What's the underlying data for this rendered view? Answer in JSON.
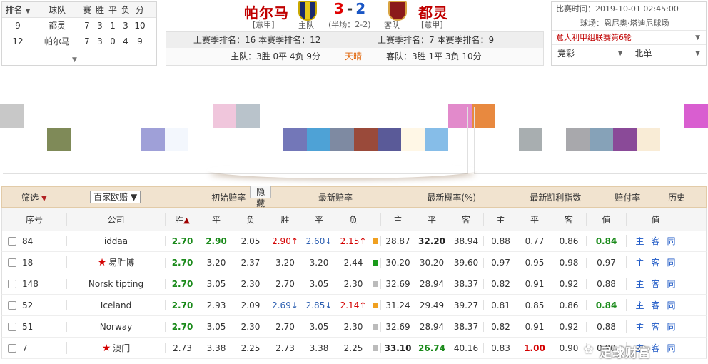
{
  "standings": {
    "headers": [
      "排名",
      "球队",
      "赛",
      "胜",
      "平",
      "负",
      "分"
    ],
    "rows": [
      {
        "rank": "9",
        "team": "都灵",
        "p": "7",
        "w": "3",
        "d": "1",
        "l": "3",
        "pts": "10"
      },
      {
        "rank": "12",
        "team": "帕尔马",
        "p": "7",
        "w": "3",
        "d": "0",
        "l": "4",
        "pts": "9"
      }
    ]
  },
  "match": {
    "home": "帕尔马",
    "away": "都灵",
    "home_league": "[意甲]",
    "away_league": "[意甲]",
    "home_caption": "主队",
    "away_caption": "客队",
    "score_home": "3",
    "score_sep": "-",
    "score_away": "2",
    "half": "(半场：2-2)",
    "home_rank_line": "上赛季排名：16 本赛季排名：12",
    "away_rank_line": "上赛季排名：7 本赛季排名：9",
    "home_record": "主队：3胜 0平 4负 9分",
    "weather": "天晴",
    "away_record": "客队：3胜 1平 3负 10分"
  },
  "right_panel": {
    "time": "比赛时间：2019-10-01 02:45:00",
    "venue": "球场：恩尼奥·塔迪尼球场",
    "round": "意大利甲组联赛第6轮",
    "select1": "竞彩",
    "select2": "北单"
  },
  "toolbar": {
    "filter": "筛选",
    "company_select": "百家欧赔",
    "initial": "初始赔率",
    "hide": "隐藏",
    "latest": "最新赔率",
    "prob": "最新概率(%)",
    "kelly": "最新凯利指数",
    "payout": "赔付率",
    "history": "历史"
  },
  "columns": {
    "idx": "序号",
    "company": "公司",
    "win": "胜",
    "draw": "平",
    "loss": "负",
    "h": "主",
    "d": "平",
    "a": "客",
    "val": "值",
    "val2": "值"
  },
  "rows": [
    {
      "idx": "84",
      "company": "iddaa",
      "star": false,
      "i_w": "2.70",
      "i_d": "2.90",
      "i_l": "2.05",
      "l_w": "2.90↑",
      "l_d": "2.60↓",
      "l_l": "2.15↑",
      "sq": "#f0a020",
      "p_h": "28.87",
      "p_d": "32.20",
      "p_a": "38.94",
      "k_h": "0.88",
      "k_d": "0.77",
      "k_a": "0.86",
      "pay": "0.84",
      "links": [
        "主",
        "客",
        "同"
      ]
    },
    {
      "idx": "18",
      "company": "易胜博",
      "star": true,
      "i_w": "2.70",
      "i_d": "3.20",
      "i_l": "2.37",
      "l_w": "3.20",
      "l_d": "3.20",
      "l_l": "2.44",
      "sq": "#1a9a1a",
      "p_h": "30.20",
      "p_d": "30.20",
      "p_a": "39.60",
      "k_h": "0.97",
      "k_d": "0.95",
      "k_a": "0.98",
      "pay": "0.97",
      "links": [
        "主",
        "客",
        "同"
      ]
    },
    {
      "idx": "148",
      "company": "Norsk tipting",
      "star": false,
      "i_w": "2.70",
      "i_d": "3.05",
      "i_l": "2.30",
      "l_w": "2.70",
      "l_d": "3.05",
      "l_l": "2.30",
      "sq": "#bbbbbb",
      "p_h": "32.69",
      "p_d": "28.94",
      "p_a": "38.37",
      "k_h": "0.82",
      "k_d": "0.91",
      "k_a": "0.92",
      "pay": "0.88",
      "links": [
        "主",
        "客",
        "同"
      ]
    },
    {
      "idx": "52",
      "company": "Iceland",
      "star": false,
      "i_w": "2.70",
      "i_d": "2.93",
      "i_l": "2.09",
      "l_w": "2.69↓",
      "l_d": "2.85↓",
      "l_l": "2.14↑",
      "sq": "#f0a020",
      "p_h": "31.24",
      "p_d": "29.49",
      "p_a": "39.27",
      "k_h": "0.81",
      "k_d": "0.85",
      "k_a": "0.86",
      "pay": "0.84",
      "links": [
        "主",
        "客",
        "同"
      ]
    },
    {
      "idx": "51",
      "company": "Norway",
      "star": false,
      "i_w": "2.70",
      "i_d": "3.05",
      "i_l": "2.30",
      "l_w": "2.70",
      "l_d": "3.05",
      "l_l": "2.30",
      "sq": "#bbbbbb",
      "p_h": "32.69",
      "p_d": "28.94",
      "p_a": "38.37",
      "k_h": "0.82",
      "k_d": "0.91",
      "k_a": "0.92",
      "pay": "0.88",
      "links": [
        "主",
        "客",
        "同"
      ]
    },
    {
      "idx": "7",
      "company": "澳门",
      "star": true,
      "i_w": "2.73",
      "i_d": "3.38",
      "i_l": "2.25",
      "l_w": "2.73",
      "l_d": "3.38",
      "l_l": "2.25",
      "sq": "#bbbbbb",
      "p_h": "33.10",
      "p_d": "26.74",
      "p_a": "40.16",
      "k_h": "0.83",
      "k_d": "1.00",
      "k_a": "0.90",
      "pay": "0.90",
      "links": [
        "主",
        "客",
        "同"
      ]
    }
  ],
  "watermark": "足球财富",
  "colors": {
    "toolbar_bg": "#f1e3cf",
    "home_red": "#c00000",
    "away_blue": "#1a56c5",
    "win_green": "#1a8a1a"
  }
}
